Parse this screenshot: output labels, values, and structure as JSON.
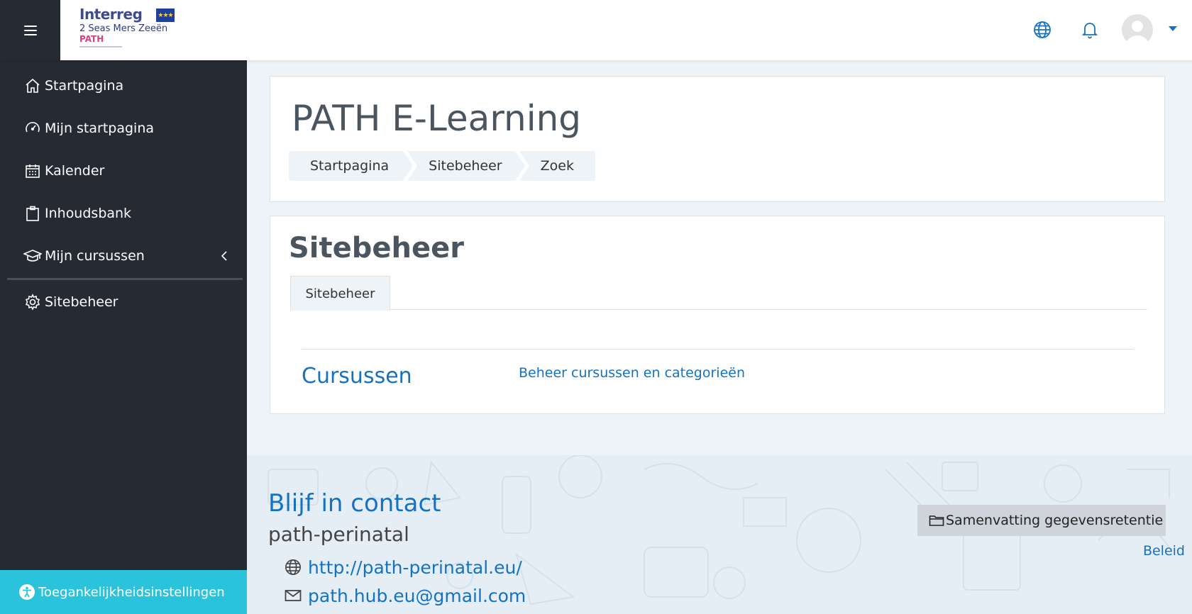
{
  "header": {
    "logo": {
      "line1": "Interreg",
      "line2": "2 Seas Mers Zeeën",
      "line3": "PATH"
    }
  },
  "sidebar": {
    "items": [
      {
        "label": "Startpagina",
        "icon": "home-icon"
      },
      {
        "label": "Mijn startpagina",
        "icon": "dashboard-icon"
      },
      {
        "label": "Kalender",
        "icon": "calendar-icon"
      },
      {
        "label": "Inhoudsbank",
        "icon": "clipboard-icon"
      },
      {
        "label": "Mijn cursussen",
        "icon": "graduation-cap-icon"
      },
      {
        "label": "Sitebeheer",
        "icon": "gear-icon"
      }
    ],
    "accessibility_label": "Toegankelijkheidsinstellingen"
  },
  "page": {
    "title": "PATH E-Learning",
    "breadcrumb": [
      "Startpagina",
      "Sitebeheer",
      "Zoek"
    ]
  },
  "admin": {
    "heading": "Sitebeheer",
    "tab": "Sitebeheer",
    "row_title": "Cursussen",
    "row_link": "Beheer cursussen en categorieën"
  },
  "footer": {
    "title": "Blijf in contact",
    "org": "path-perinatal",
    "website": "http://path-perinatal.eu/",
    "email": "path.hub.eu@gmail.com",
    "retention_button": "Samenvatting gegevensretentie",
    "policy_link": "Beleid"
  },
  "colors": {
    "sidebar": "#252a33",
    "accent": "#1572c2",
    "a11y": "#2bc3dc"
  }
}
